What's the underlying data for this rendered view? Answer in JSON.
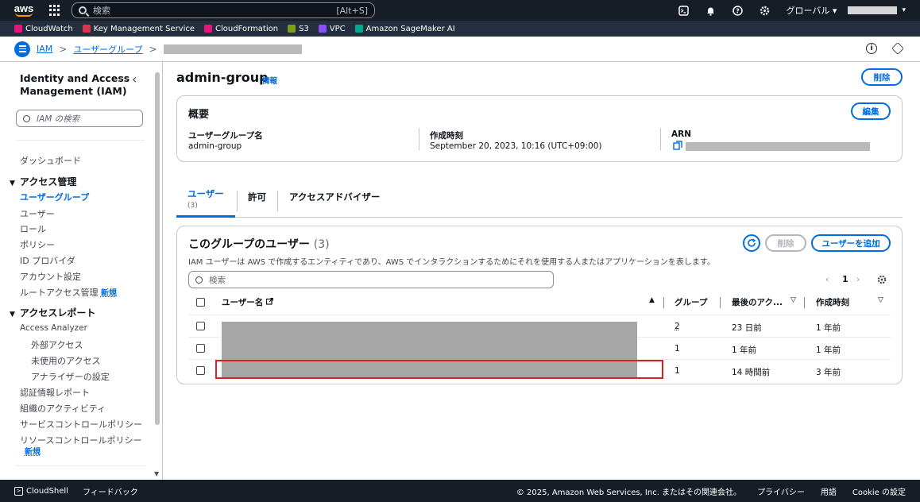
{
  "topnav": {
    "logo_text": "aws",
    "search_placeholder": "検索",
    "search_hint": "[Alt+S]",
    "region_label": "グローバル ▾",
    "account_caret": "▾"
  },
  "favorites": [
    {
      "label": "CloudWatch",
      "color": "#e7157b"
    },
    {
      "label": "Key Management Service",
      "color": "#dd344c"
    },
    {
      "label": "CloudFormation",
      "color": "#e7157b"
    },
    {
      "label": "S3",
      "color": "#7aa116"
    },
    {
      "label": "VPC",
      "color": "#8c4fff"
    },
    {
      "label": "Amazon SageMaker AI",
      "color": "#01a88d"
    }
  ],
  "breadcrumb": {
    "root": "IAM",
    "sep": ">",
    "level2": "ユーザーグループ"
  },
  "sidebar": {
    "title": "Identity and Access Management (IAM)",
    "close": "‹",
    "search_placeholder": "IAM の検索",
    "dashboard": "ダッシュボード",
    "section_access": "アクセス管理",
    "access_items": [
      "ユーザーグループ",
      "ユーザー",
      "ロール",
      "ポリシー",
      "ID プロバイダ",
      "アカウント設定",
      "ルートアクセス管理"
    ],
    "new_badge": "新規",
    "section_reports": "アクセスレポート",
    "access_analyzer": "Access Analyzer",
    "analyzer_items": [
      "外部アクセス",
      "未使用のアクセス",
      "アナライザーの設定"
    ],
    "report_items": [
      "認証情報レポート",
      "組織のアクティビティ",
      "サービスコントロールポリシー",
      "リソースコントロールポリシー"
    ],
    "triangle": "▼"
  },
  "page": {
    "title": "admin-group",
    "info": "情報",
    "delete_button": "削除"
  },
  "summary": {
    "title": "概要",
    "edit_button": "編集",
    "group_name_label": "ユーザーグループ名",
    "group_name_value": "admin-group",
    "created_label": "作成時刻",
    "created_value": "September 20, 2023, 10:16 (UTC+09:00)",
    "arn_label": "ARN"
  },
  "tabs": [
    {
      "label": "ユーザー",
      "count": "(3)"
    },
    {
      "label": "許可"
    },
    {
      "label": "アクセスアドバイザー"
    }
  ],
  "users_panel": {
    "title": "このグループのユーザー",
    "count": "(3)",
    "description": "IAM ユーザーは AWS で作成するエンティティであり、AWS でインタラクションするためにそれを使用する人またはアプリケーションを表します。",
    "remove_button": "削除",
    "add_button": "ユーザーを追加",
    "search_placeholder": "検索",
    "page_number": "1",
    "prev": "‹",
    "next": "›",
    "columns": [
      "ユーザー名",
      "グループ",
      "最後のアク...",
      "作成時刻"
    ],
    "rows": [
      {
        "groups": "2",
        "last_activity": "23 日前",
        "created": "1 年前"
      },
      {
        "groups": "1",
        "last_activity": "1 年前",
        "created": "1 年前"
      },
      {
        "groups": "1",
        "last_activity": "14 時間前",
        "created": "3 年前"
      }
    ]
  },
  "footer": {
    "cloudshell": "CloudShell",
    "feedback": "フィードバック",
    "copyright": "© 2025, Amazon Web Services, Inc. またはその関連会社。",
    "privacy": "プライバシー",
    "terms": "用語",
    "cookies": "Cookie の設定"
  }
}
